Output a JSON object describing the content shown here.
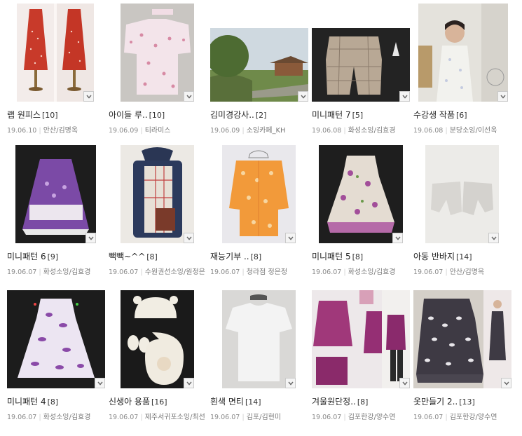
{
  "posts": [
    {
      "title": "랩 원피스",
      "count": "[10]",
      "date": "19.06.10",
      "author": "안산/김명옥",
      "image": "red-polka-dot-dresses"
    },
    {
      "title": "아이들 루..",
      "count": "[10]",
      "date": "19.06.09",
      "author": "티라미스",
      "image": "pink-floral-blouse-pattern"
    },
    {
      "title": "김미경강사..",
      "count": "[2]",
      "date": "19.06.09",
      "author": "소잉카페_KH",
      "image": "park-pavilion-photo"
    },
    {
      "title": "미니패턴 7",
      "count": "[5]",
      "date": "19.06.08",
      "author": "화성소잉/김효경",
      "image": "plaid-shorts"
    },
    {
      "title": "수강생 작품",
      "count": "[6]",
      "date": "19.06.08",
      "author": "분당소잉/이선옥",
      "image": "woman-in-floral-dress"
    },
    {
      "title": "미니패턴 6",
      "count": "[9]",
      "date": "19.06.07",
      "author": "화성소잉/김효경",
      "image": "purple-child-dress"
    },
    {
      "title": "빽빽~^^",
      "count": "[8]",
      "date": "19.06.07",
      "author": "수원권선소잉/원정은",
      "image": "plaid-backpack"
    },
    {
      "title": "재능기부 ..",
      "count": "[8]",
      "date": "19.06.07",
      "author": "청라점 정은정",
      "image": "orange-floral-cardigan"
    },
    {
      "title": "미니패턴 5",
      "count": "[8]",
      "date": "19.06.07",
      "author": "화성소잉/김효경",
      "image": "floral-ruffle-dress"
    },
    {
      "title": "아동 반바지",
      "count": "[14]",
      "date": "19.06.07",
      "author": "안산/김명옥",
      "image": "white-shorts"
    },
    {
      "title": "미니패턴 4",
      "count": "[8]",
      "date": "19.06.07",
      "author": "화성소잉/김효경",
      "image": "paisley-dress"
    },
    {
      "title": "신생아 용품",
      "count": "[16]",
      "date": "19.06.07",
      "author": "제주서귀포소잉/최선",
      "image": "baby-hat-mittens-bib"
    },
    {
      "title": "흰색 면티",
      "count": "[14]",
      "date": "19.06.07",
      "author": "김포/김현미",
      "image": "white-tshirt"
    },
    {
      "title": "겨울원단정..",
      "count": "[8]",
      "date": "19.06.07",
      "author": "김포한강/양수연",
      "image": "purple-knit-tops"
    },
    {
      "title": "옷만들기 2..",
      "count": "[13]",
      "date": "19.06.07",
      "author": "김포한강/양수연",
      "image": "patterned-ruffle-dress"
    }
  ],
  "icons": {
    "dropdown": "chevron-down-icon"
  }
}
